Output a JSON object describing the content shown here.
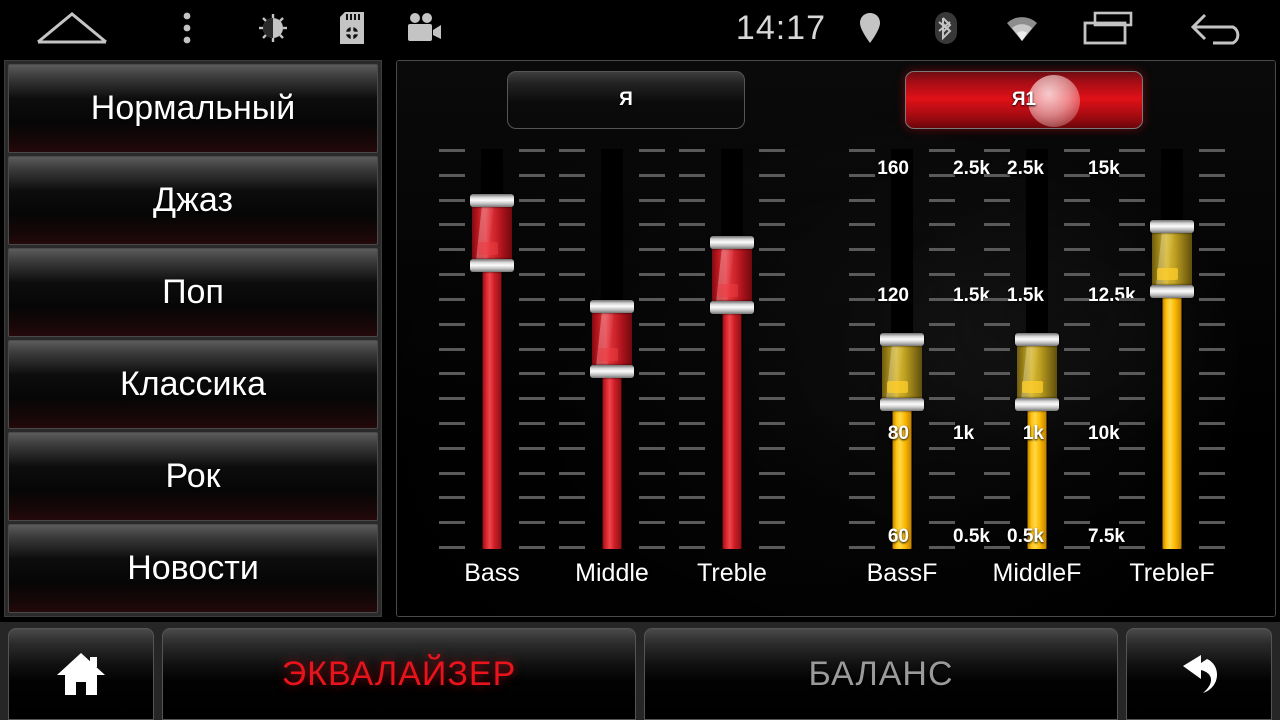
{
  "statusbar": {
    "clock": "14:17",
    "left_icons": [
      "home-icon",
      "overflow-menu-icon",
      "brightness-icon",
      "sdcard-icon",
      "camera-icon"
    ],
    "right_icons": [
      "location-pin-icon",
      "bluetooth-icon",
      "wifi-icon",
      "recents-icon",
      "back-icon"
    ]
  },
  "presets": {
    "items": [
      {
        "label": "Нормальный"
      },
      {
        "label": "Джаз"
      },
      {
        "label": "Поп"
      },
      {
        "label": "Классика"
      },
      {
        "label": "Рок"
      },
      {
        "label": "Новости"
      }
    ]
  },
  "equalizer": {
    "top_buttons": [
      {
        "label": "Я",
        "active": false
      },
      {
        "label": "Я1",
        "active": true
      }
    ],
    "gain_sliders": [
      {
        "label": "Bass",
        "color": "#d5232c",
        "value_pct": 86
      },
      {
        "label": "Middle",
        "color": "#d5232c",
        "value_pct": 53
      },
      {
        "label": "Treble",
        "color": "#d5232c",
        "value_pct": 73
      }
    ],
    "freq_sliders": [
      {
        "label": "BassF",
        "color": "#ffc20a",
        "value_pct": 43,
        "scale_left": [
          "160",
          "120",
          "80",
          "60"
        ],
        "scale_right": [
          "2.5k",
          "1.5k",
          "1k",
          "0.5k"
        ]
      },
      {
        "label": "MiddleF",
        "color": "#ffc20a",
        "value_pct": 43,
        "scale_left": [
          "2.5k",
          "1.5k",
          "1k",
          "0.5k"
        ],
        "scale_right": [
          "15k",
          "12.5k",
          "10k",
          "7.5k"
        ]
      },
      {
        "label": "TrebleF",
        "color": "#ffc20a",
        "value_pct": 78,
        "scale_left": [],
        "scale_right": []
      }
    ]
  },
  "bottombar": {
    "home_label": "home-icon",
    "tab_equalizer": "ЭКВАЛАЙЗЕР",
    "tab_balance": "БАЛАНС",
    "back_label": "back-arrow-icon",
    "active_tab": "ЭКВАЛАЙЗЕР",
    "active_color": "#e8131b",
    "inactive_color": "#9a9a9a"
  }
}
